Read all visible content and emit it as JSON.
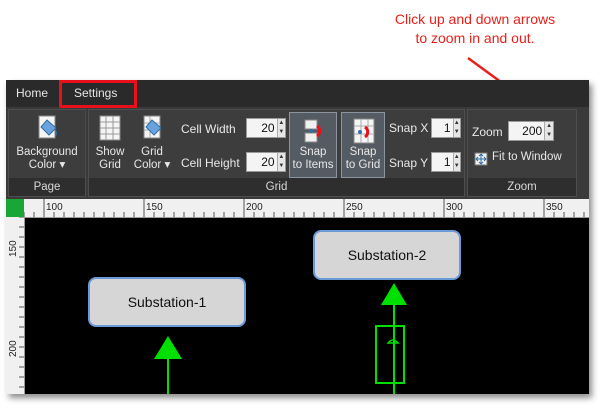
{
  "callout": {
    "line1": "Click up and down arrows",
    "line2": "to zoom in and out."
  },
  "tabs": {
    "home": "Home",
    "settings": "Settings"
  },
  "ribbon": {
    "page": {
      "label": "Page",
      "background_color_line1": "Background",
      "background_color_line2": "Color ▾"
    },
    "grid": {
      "label": "Grid",
      "show_grid_line1": "Show",
      "show_grid_line2": "Grid",
      "grid_color_line1": "Grid",
      "grid_color_line2": "Color ▾",
      "cell_width_label": "Cell Width",
      "cell_width_value": "20",
      "cell_height_label": "Cell Height",
      "cell_height_value": "20",
      "snap_items_line1": "Snap",
      "snap_items_line2": "to Items",
      "snap_grid_line1": "Snap",
      "snap_grid_line2": "to Grid",
      "snap_x_label": "Snap X",
      "snap_x_value": "1",
      "snap_y_label": "Snap Y",
      "snap_y_value": "1"
    },
    "zoom": {
      "label": "Zoom",
      "zoom_label": "Zoom",
      "zoom_value": "200",
      "fit_to_window": "Fit to Window"
    }
  },
  "rulers": {
    "horizontal": [
      "100",
      "150",
      "200",
      "250",
      "300",
      "350"
    ],
    "vertical": [
      "150",
      "200"
    ]
  },
  "canvas": {
    "node1": "Substation-1",
    "node2": "Substation-2"
  },
  "colors": {
    "accent_red": "#e8101a",
    "connector_green": "#00e000",
    "node_border": "#6a9ad8"
  }
}
